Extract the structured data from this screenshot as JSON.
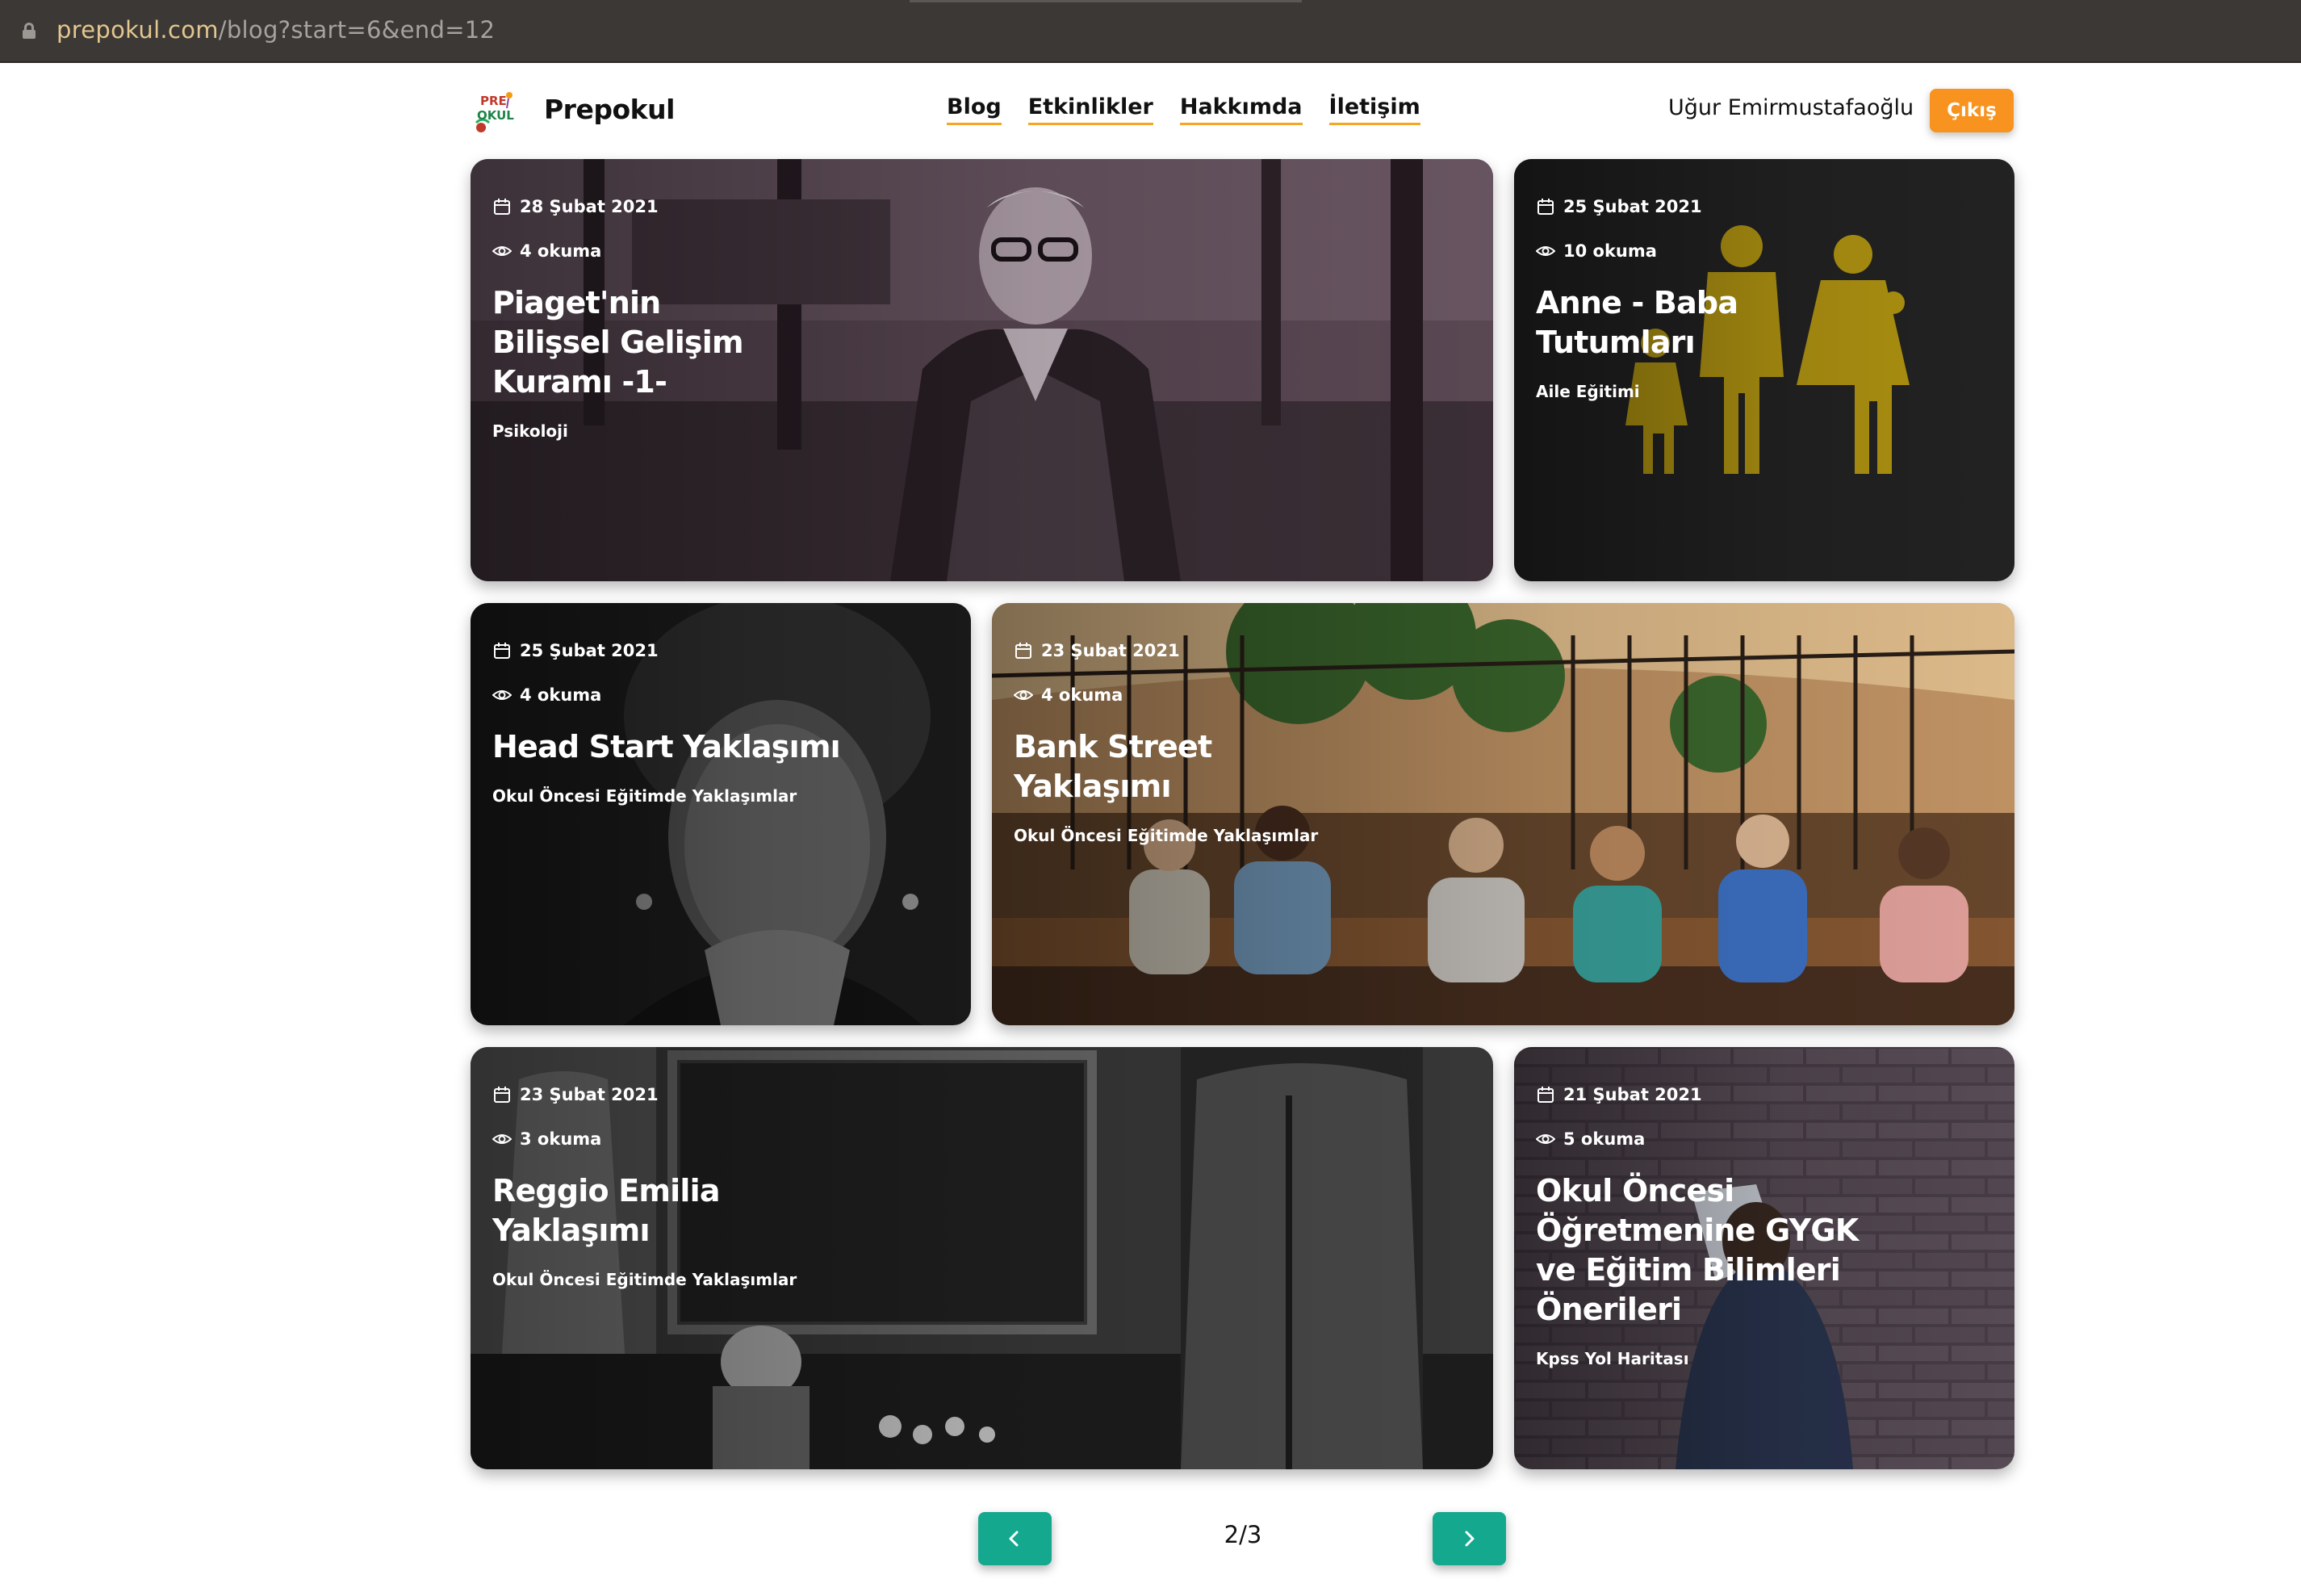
{
  "browser": {
    "url_host": "prepokul.com",
    "url_path": "/blog?start=6&end=12"
  },
  "header": {
    "brand": "Prepokul",
    "logo_text_top": "PRE",
    "logo_text_bottom": "OKUL",
    "nav": [
      "Blog",
      "Etkinlikler",
      "Hakkımda",
      "İletişim"
    ],
    "user_name": "Uğur Emirmustafaoğlu",
    "logout_label": "Çıkış"
  },
  "posts": [
    {
      "date": "28 Şubat 2021",
      "reads": "4 okuma",
      "title": "Piaget'nin Bilişsel Gelişim Kuramı -1-",
      "category": "Psikoloji",
      "image": "elderly-man-portrait"
    },
    {
      "date": "25 Şubat 2021",
      "reads": "10 okuma",
      "title": "Anne - Baba Tutumları",
      "category": "Aile Eğitimi",
      "image": "family-pictogram-on-asphalt"
    },
    {
      "date": "25 Şubat 2021",
      "reads": "4 okuma",
      "title": "Head Start Yaklaşımı",
      "category": "Okul Öncesi Eğitimde Yaklaşımlar",
      "image": "woman-portrait-bw"
    },
    {
      "date": "23 Şubat 2021",
      "reads": "4 okuma",
      "title": "Bank Street Yaklaşımı",
      "category": "Okul Öncesi Eğitimde Yaklaşımlar",
      "image": "children-reading-on-bench"
    },
    {
      "date": "23 Şubat 2021",
      "reads": "3 okuma",
      "title": "Reggio Emilia Yaklaşımı",
      "category": "Okul Öncesi Eğitimde Yaklaşımlar",
      "image": "classroom-bw"
    },
    {
      "date": "21 Şubat 2021",
      "reads": "5 okuma",
      "title": "Okul Öncesi Öğretmenine GYGK ve Eğitim Bilimleri Önerileri",
      "category": "Kpss Yol Haritası",
      "image": "person-reading-brick-wall"
    }
  ],
  "pagination": {
    "label": "2/3",
    "prev_icon": "chevron-left-icon",
    "next_icon": "chevron-right-icon"
  },
  "colors": {
    "accent_orange": "#f7931e",
    "pagination_teal": "#14a98f",
    "url_bar": "#3b3835"
  }
}
